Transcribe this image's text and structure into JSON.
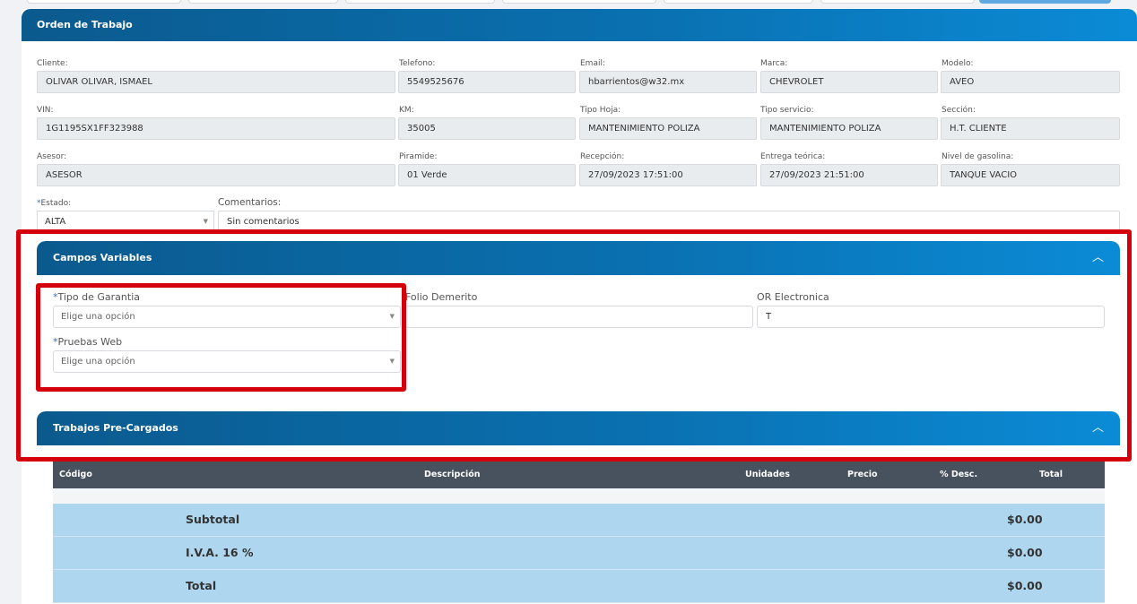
{
  "order": {
    "title": "Orden de Trabajo",
    "fields": [
      {
        "label": "Cliente:",
        "value": "OLIVAR OLIVAR, ISMAEL"
      },
      {
        "label": "Telefono:",
        "value": "5549525676"
      },
      {
        "label": "Email:",
        "value": "hbarrientos@w32.mx"
      },
      {
        "label": "Marca:",
        "value": "CHEVROLET"
      },
      {
        "label": "Modelo:",
        "value": "AVEO"
      },
      {
        "label": "VIN:",
        "value": "1G1195SX1FF323988"
      },
      {
        "label": "KM:",
        "value": "35005"
      },
      {
        "label": "Tipo Hoja:",
        "value": "MANTENIMIENTO POLIZA"
      },
      {
        "label": "Tipo servicio:",
        "value": "MANTENIMIENTO POLIZA"
      },
      {
        "label": "Sección:",
        "value": "H.T. CLIENTE"
      },
      {
        "label": "Asesor:",
        "value": "ASESOR"
      },
      {
        "label": "Piramide:",
        "value": "01 Verde"
      },
      {
        "label": "Recepción:",
        "value": "27/09/2023 17:51:00"
      },
      {
        "label": "Entrega teórica:",
        "value": "27/09/2023 21:51:00"
      },
      {
        "label": "Nivel de gasolina:",
        "value": "TANQUE VACIO"
      }
    ],
    "estado": {
      "required": "*",
      "label": "Estado:",
      "value": "ALTA"
    },
    "comentarios": {
      "label": "Comentarios:",
      "value": "Sin comentarios"
    }
  },
  "campos": {
    "title": "Campos Variables",
    "tipo_garantia": {
      "required": "*",
      "label": "Tipo de Garantia",
      "placeholder": "Elige una opción"
    },
    "pruebas_web": {
      "required": "*",
      "label": "Pruebas Web",
      "placeholder": "Elige una opción"
    },
    "folio": {
      "label": "Folio Demerito",
      "value": ""
    },
    "or_electronica": {
      "label": "OR Electronica",
      "value": "T"
    }
  },
  "trabajos": {
    "title": "Trabajos Pre-Cargados",
    "columns": [
      "Código",
      "Descripción",
      "Unidades",
      "Precio",
      "% Desc.",
      "Total"
    ],
    "totals": [
      {
        "label": "Subtotal",
        "value": "$0.00"
      },
      {
        "label": "I.V.A. 16 %",
        "value": "$0.00"
      },
      {
        "label": "Total",
        "value": "$0.00"
      }
    ]
  },
  "icons": {
    "collapse": "chevron-up-icon",
    "dropdown": "caret-down-icon"
  },
  "colors": {
    "header_start": "#0b5a8e",
    "header_end": "#0b8bd6",
    "highlight": "#d4000c",
    "table_head": "#47525e",
    "totals_bg": "#aed6ee"
  }
}
